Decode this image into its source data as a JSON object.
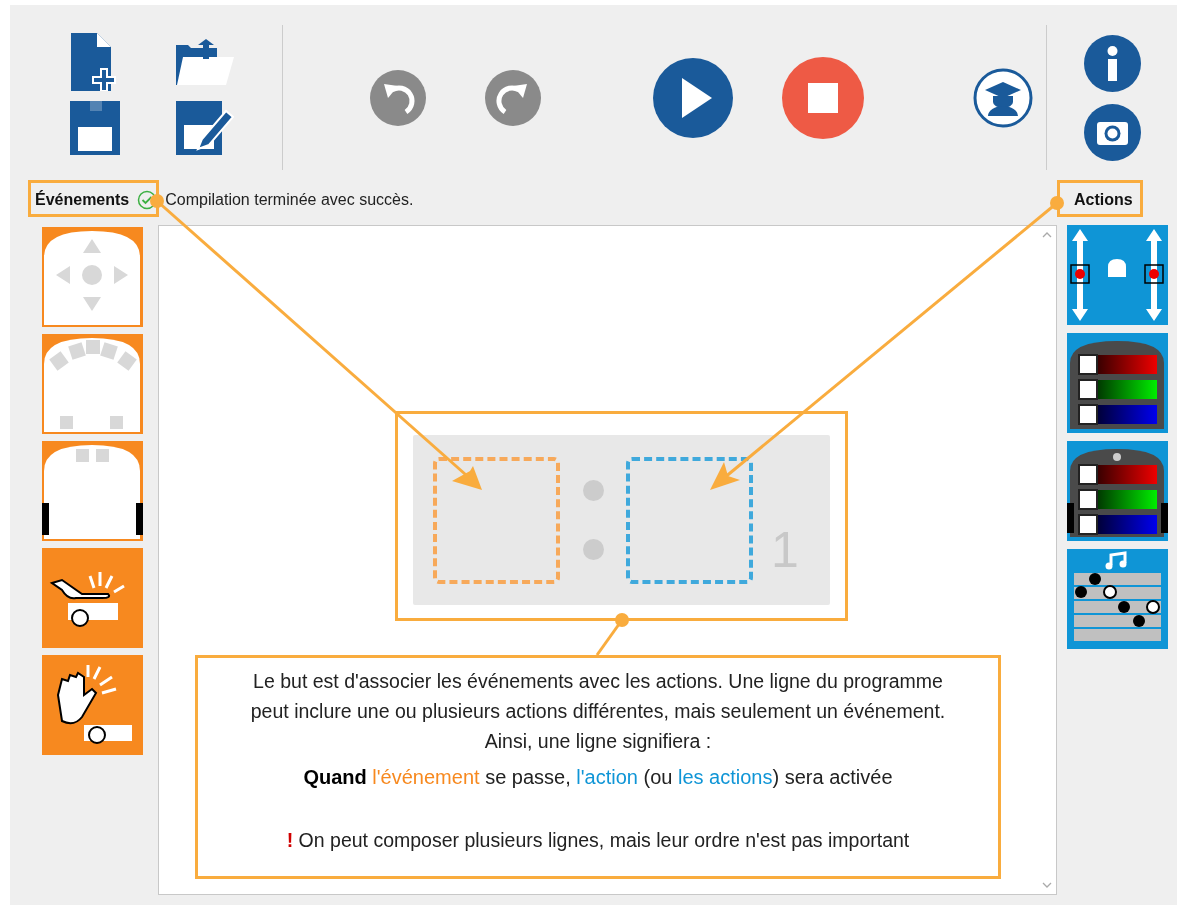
{
  "toolbar": {
    "file_buttons": [
      {
        "kind": "new"
      },
      {
        "kind": "open"
      },
      {
        "kind": "save"
      },
      {
        "kind": "save-as"
      }
    ],
    "edit_buttons": [
      {
        "kind": "undo"
      },
      {
        "kind": "redo"
      },
      {
        "kind": "play"
      },
      {
        "kind": "stop"
      },
      {
        "kind": "teacher"
      }
    ],
    "side_buttons": [
      {
        "kind": "info"
      },
      {
        "kind": "camera"
      }
    ]
  },
  "events_label": "Événements",
  "status": {
    "kind": "success",
    "text": "Compilation terminée avec succès."
  },
  "actions_label": "Actions",
  "events": [
    {
      "kind": "buttons"
    },
    {
      "kind": "proximity"
    },
    {
      "kind": "ground"
    },
    {
      "kind": "tap"
    },
    {
      "kind": "clap"
    }
  ],
  "actions": [
    {
      "kind": "motors"
    },
    {
      "kind": "top-color"
    },
    {
      "kind": "bottom-color"
    },
    {
      "kind": "music"
    }
  ],
  "program_line": {
    "number": "1"
  },
  "callout": {
    "paragraph": "Le but est d'associer les événements avec les actions. Une ligne du programme peut inclure une ou plusieurs actions différentes, mais seulement un événement. Ainsi, une ligne signifiera :",
    "rule": [
      {
        "kind": "strong",
        "text": "Quand "
      },
      {
        "kind": "event",
        "text": "l'événement"
      },
      {
        "kind": "plain",
        "text": " se passe, "
      },
      {
        "kind": "action",
        "text": "l'action"
      },
      {
        "kind": "plain",
        "text": " (ou "
      },
      {
        "kind": "action",
        "text": "les actions"
      },
      {
        "kind": "plain",
        "text": ") sera activée"
      }
    ],
    "note": [
      {
        "kind": "warning",
        "text": "!"
      },
      {
        "kind": "plain",
        "text": " On peut composer plusieurs lignes, mais leur ordre n'est pas important"
      }
    ]
  }
}
